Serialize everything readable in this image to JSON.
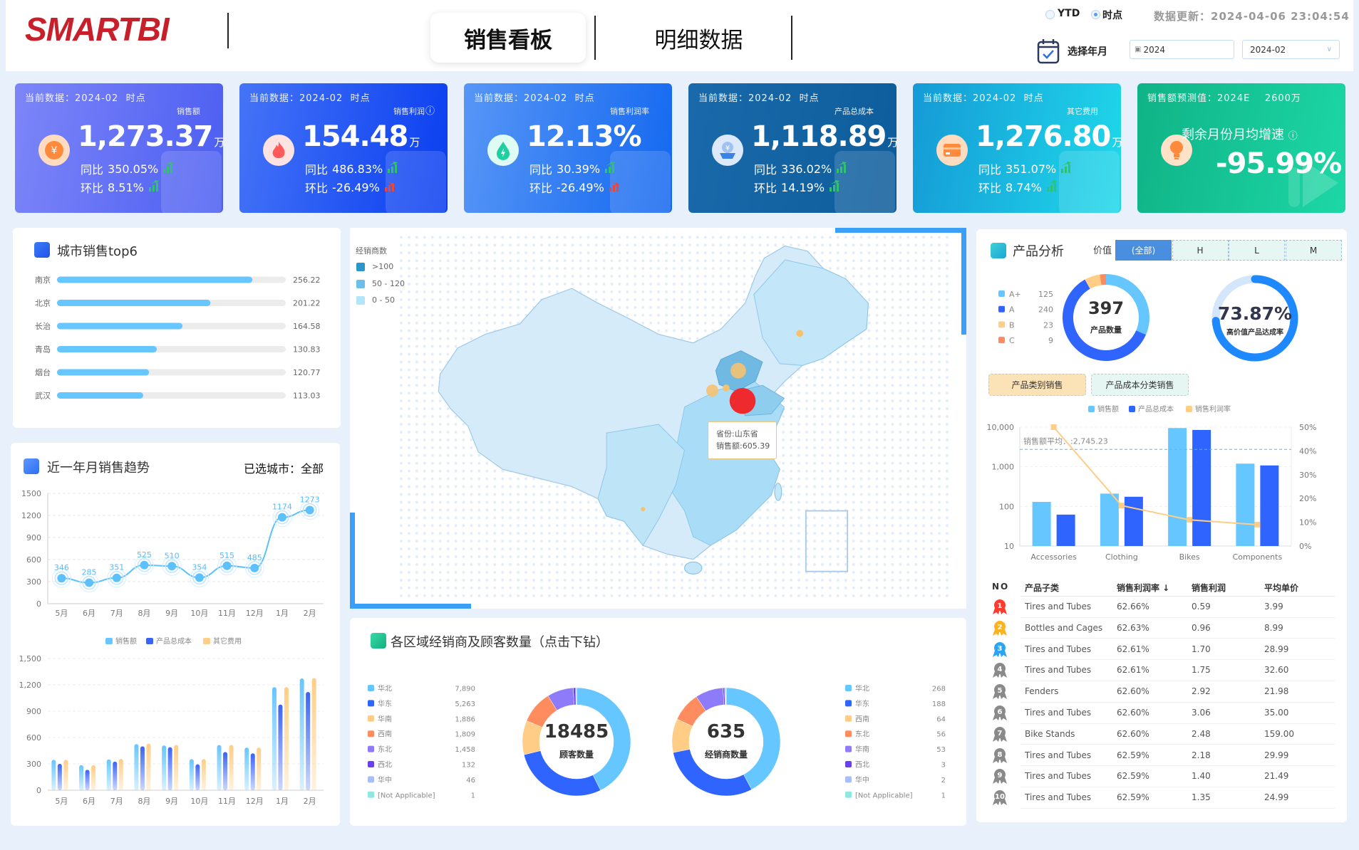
{
  "header": {
    "logo": "SMARTBI",
    "tabs": [
      {
        "label": "销售看板",
        "active": true
      },
      {
        "label": "明细数据",
        "active": false
      }
    ],
    "radios": [
      {
        "label": "YTD",
        "selected": false
      },
      {
        "label": "时点",
        "selected": true
      }
    ],
    "update_label": "数据更新：2024-04-06 23:04:54",
    "select_label": "选择年月",
    "year_input": "2024",
    "month_select": "2024-02"
  },
  "kpis": [
    {
      "header": "当前数据：2024-02  时点",
      "metric": "销售额",
      "value": "1,273.37",
      "unit": "万",
      "yoy_label": "同比",
      "yoy": "350.05%",
      "yoy_trend": "up",
      "mom_label": "环比",
      "mom": "8.51%",
      "mom_trend": "up",
      "icon": "yuan-icon"
    },
    {
      "header": "当前数据：2024-02  时点",
      "metric": "销售利润",
      "value": "154.48",
      "unit": "万",
      "yoy_label": "同比",
      "yoy": "486.83%",
      "yoy_trend": "up",
      "mom_label": "环比",
      "mom": "-26.49%",
      "mom_trend": "down",
      "icon": "fire-icon"
    },
    {
      "header": "当前数据：2024-02  时点",
      "metric": "销售利润率",
      "value": "12.13%",
      "unit": "",
      "yoy_label": "同比",
      "yoy": "30.39%",
      "yoy_trend": "up",
      "mom_label": "环比",
      "mom": "-26.49%",
      "mom_trend": "down",
      "icon": "drop-icon"
    },
    {
      "header": "当前数据：2024-02  时点",
      "metric": "产品总成本",
      "value": "1,118.89",
      "unit": "万",
      "yoy_label": "同比",
      "yoy": "336.02%",
      "yoy_trend": "up",
      "mom_label": "环比",
      "mom": "14.19%",
      "mom_trend": "up",
      "icon": "coin-hand-icon"
    },
    {
      "header": "当前数据：2024-02  时点",
      "metric": "其它费用",
      "value": "1,276.80",
      "unit": "万",
      "yoy_label": "同比",
      "yoy": "351.07%",
      "yoy_trend": "up",
      "mom_label": "环比",
      "mom": "8.74%",
      "mom_trend": "up",
      "icon": "card-icon"
    }
  ],
  "forecast": {
    "header": "销售额预测值：2024E    2600万",
    "metric": "剩余月份月均增速",
    "value": "-95.99%",
    "icon": "bulb-icon"
  },
  "colors": {
    "up": "#2fc46b",
    "down": "#e8483a",
    "light_blue": "#66c6ff",
    "blue": "#3064ff",
    "orange": "#ffcd86"
  },
  "city": {
    "title": "城市销售top6"
  },
  "trend": {
    "title": "近一年月销售趋势",
    "selected_city": "已选城市：全部"
  },
  "map": {
    "legend_title": "经销商数",
    "legend": [
      {
        "label": ">100",
        "color": "#2b96c9"
      },
      {
        "label": "50 - 120",
        "color": "#6cbfe6"
      },
      {
        "label": "0 - 50",
        "color": "#b2e4fa"
      }
    ],
    "tooltip": {
      "province": "省份:山东省",
      "sales": "销售额:605.39"
    }
  },
  "region": {
    "title": "各区域经销商及顾客数量（点击下钻）"
  },
  "product": {
    "title": "产品分析",
    "filter_label": "价值",
    "filters": [
      {
        "label": "(全部)",
        "active": true
      },
      {
        "label": "H",
        "active": false
      },
      {
        "label": "L",
        "active": false
      },
      {
        "label": "M",
        "active": false
      }
    ],
    "gauge_value": "73.87%",
    "gauge_fraction": 0.7387,
    "gauge_label": "高价值产品达成率",
    "tabs": [
      {
        "label": "产品类别销售",
        "active": true
      },
      {
        "label": "产品成本分类销售",
        "active": false
      }
    ],
    "table": {
      "columns": [
        "NO",
        "产品子类",
        "销售利润率 ↓",
        "销售利润",
        "平均单价"
      ],
      "rows": [
        {
          "rank": "1",
          "name": "Tires and Tubes",
          "rate": "62.66%",
          "profit": "0.59",
          "price": "3.99"
        },
        {
          "rank": "2",
          "name": "Bottles and Cages",
          "rate": "62.63%",
          "profit": "0.96",
          "price": "8.99"
        },
        {
          "rank": "3",
          "name": "Tires and Tubes",
          "rate": "62.61%",
          "profit": "1.70",
          "price": "28.99"
        },
        {
          "rank": "4",
          "name": "Tires and Tubes",
          "rate": "62.61%",
          "profit": "1.75",
          "price": "32.60"
        },
        {
          "rank": "5",
          "name": "Fenders",
          "rate": "62.60%",
          "profit": "2.92",
          "price": "21.98"
        },
        {
          "rank": "6",
          "name": "Tires and Tubes",
          "rate": "62.60%",
          "profit": "3.06",
          "price": "35.00"
        },
        {
          "rank": "7",
          "name": "Bike Stands",
          "rate": "62.60%",
          "profit": "2.48",
          "price": "159.00"
        },
        {
          "rank": "8",
          "name": "Tires and Tubes",
          "rate": "62.59%",
          "profit": "2.18",
          "price": "29.99"
        },
        {
          "rank": "9",
          "name": "Tires and Tubes",
          "rate": "62.59%",
          "profit": "1.40",
          "price": "21.49"
        },
        {
          "rank": "10",
          "name": "Tires and Tubes",
          "rate": "62.59%",
          "profit": "1.35",
          "price": "24.99"
        }
      ]
    }
  },
  "chart_data": [
    {
      "id": "city_top6",
      "type": "bar",
      "orientation": "horizontal",
      "categories": [
        "南京",
        "北京",
        "长治",
        "青岛",
        "烟台",
        "武汉"
      ],
      "values": [
        256.22,
        201.22,
        164.58,
        130.83,
        120.77,
        113.03
      ],
      "color": "#66c6ff"
    },
    {
      "id": "trend_line",
      "type": "line",
      "categories": [
        "5月",
        "6月",
        "7月",
        "8月",
        "9月",
        "10月",
        "11月",
        "12月",
        "1月",
        "2月"
      ],
      "values": [
        346,
        285,
        351,
        525,
        510,
        354,
        515,
        485,
        1174,
        1273
      ],
      "yticks": [
        "0",
        "300",
        "600",
        "900",
        "1200",
        "1500"
      ],
      "ylim": [
        0,
        1500
      ],
      "grid": true,
      "color": "#5bc0fb"
    },
    {
      "id": "trend_bars",
      "type": "bar",
      "categories": [
        "5月",
        "6月",
        "7月",
        "8月",
        "9月",
        "10月",
        "11月",
        "12月",
        "1月",
        "2月"
      ],
      "yticks": [
        "0",
        "300",
        "600",
        "900",
        "1,200",
        "1,500"
      ],
      "ylim": [
        0,
        1500
      ],
      "grid": true,
      "legend": "top",
      "series": [
        {
          "name": "销售额",
          "values": [
            346,
            285,
            351,
            525,
            510,
            354,
            515,
            485,
            1174,
            1273
          ],
          "color": "#66c6ff"
        },
        {
          "name": "产品总成本",
          "values": [
            300,
            232,
            325,
            500,
            490,
            295,
            435,
            420,
            975,
            1119
          ],
          "color": "#3a62f5"
        },
        {
          "name": "其它费用",
          "values": [
            346,
            285,
            356,
            530,
            515,
            354,
            515,
            485,
            1174,
            1277
          ],
          "color": "#ffcd86"
        }
      ]
    },
    {
      "id": "customers",
      "type": "pie",
      "donut": true,
      "total": "18485",
      "center_label": "顾客数量",
      "categories": [
        "华北",
        "华东",
        "华南",
        "西南",
        "东北",
        "西北",
        "华中",
        "[Not Applicable]"
      ],
      "values": [
        7890,
        5263,
        1886,
        1809,
        1458,
        132,
        46,
        1
      ],
      "labels": [
        "7,890",
        "5,263",
        "1,886",
        "1,809",
        "1,458",
        "132",
        "46",
        "1"
      ]
    },
    {
      "id": "dealers",
      "type": "pie",
      "donut": true,
      "total": "635",
      "center_label": "经销商数量",
      "categories": [
        "华北",
        "华东",
        "西南",
        "东北",
        "华南",
        "西北",
        "华中",
        "[Not Applicable]"
      ],
      "values": [
        268,
        188,
        64,
        56,
        53,
        3,
        2,
        1
      ],
      "labels": [
        "268",
        "188",
        "64",
        "56",
        "53",
        "3",
        "2",
        "1"
      ]
    },
    {
      "id": "product_grade",
      "type": "pie",
      "donut": true,
      "total": "397",
      "center_label": "产品数量",
      "categories": [
        "A+",
        "A",
        "B",
        "C"
      ],
      "values": [
        125,
        240,
        23,
        9
      ],
      "colors": [
        "#66c6ff",
        "#3064ff",
        "#ffcd86",
        "#ff8a5c"
      ]
    },
    {
      "id": "product_category",
      "type": "bar",
      "categories": [
        "Accessories",
        "Clothing",
        "Bikes",
        "Components"
      ],
      "yscale": "log",
      "ylim": [
        10,
        10000
      ],
      "yticks": [
        "10",
        "100",
        "1,000",
        "10,000"
      ],
      "y2lim": [
        0,
        50
      ],
      "y2ticks": [
        "0%",
        "10%",
        "20%",
        "30%",
        "40%",
        "50%"
      ],
      "legend": "top",
      "series": [
        {
          "name": "销售额",
          "type": "bar",
          "values": [
            130,
            210,
            9500,
            1200
          ],
          "color": "#66c6ff"
        },
        {
          "name": "产品总成本",
          "type": "bar",
          "values": [
            62,
            175,
            8500,
            1080
          ],
          "color": "#3064ff"
        },
        {
          "name": "销售利润率",
          "type": "line",
          "axis": "right",
          "values": [
            50,
            17,
            11,
            9
          ],
          "color": "#ffcd86"
        }
      ],
      "markline": {
        "label": "销售额平均：:2,745.23",
        "value": 2745.23
      }
    }
  ],
  "region_colors": [
    "#66c6ff",
    "#3064ff",
    "#ffcd86",
    "#ff8c5e",
    "#8d7bfa",
    "#6a3ff0",
    "#a9bdfb",
    "#8ee8e0"
  ]
}
